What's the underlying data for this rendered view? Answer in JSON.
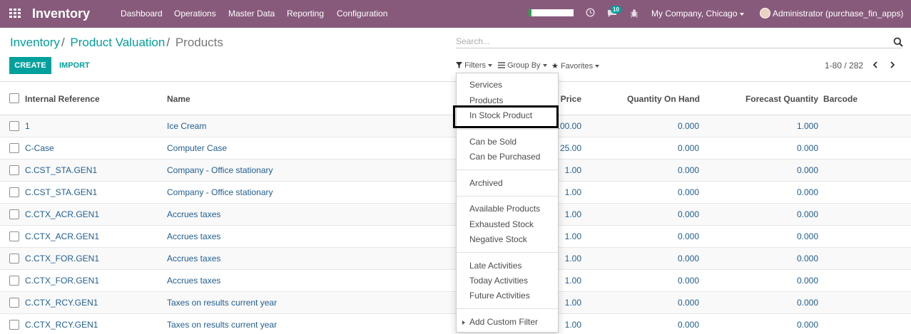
{
  "navbar": {
    "app_name": "Inventory",
    "menu": [
      "Dashboard",
      "Operations",
      "Master Data",
      "Reporting",
      "Configuration"
    ],
    "messages_count": "10",
    "company": "My Company, Chicago",
    "user": "Administrator (purchase_fin_apps)",
    "accent_color": "#875a7b"
  },
  "breadcrumb": [
    "Inventory",
    "Product Valuation",
    "Products"
  ],
  "search": {
    "placeholder": "Search..."
  },
  "buttons": {
    "create": "CREATE",
    "import": "IMPORT"
  },
  "search_options": {
    "filters": "Filters",
    "group_by": "Group By",
    "favorites": "Favorites"
  },
  "pager": {
    "value": "1-80 / 282"
  },
  "table": {
    "columns": [
      "Internal Reference",
      "Name",
      "Sales Price",
      "Quantity On Hand",
      "Forecast Quantity",
      "Barcode"
    ],
    "rows": [
      {
        "ref": "1",
        "name": "Ice Cream",
        "price": "100.00",
        "qty": "0.000",
        "forecast": "1.000"
      },
      {
        "ref": "C-Case",
        "name": "Computer Case",
        "price": "25.00",
        "qty": "0.000",
        "forecast": "0.000"
      },
      {
        "ref": "C.CST_STA.GEN1",
        "name": "Company - Office stationary",
        "price": "1.00",
        "qty": "0.000",
        "forecast": "0.000"
      },
      {
        "ref": "C.CST_STA.GEN1",
        "name": "Company - Office stationary",
        "price": "1.00",
        "qty": "0.000",
        "forecast": "0.000"
      },
      {
        "ref": "C.CTX_ACR.GEN1",
        "name": "Accrues taxes",
        "price": "1.00",
        "qty": "0.000",
        "forecast": "0.000"
      },
      {
        "ref": "C.CTX_ACR.GEN1",
        "name": "Accrues taxes",
        "price": "1.00",
        "qty": "0.000",
        "forecast": "0.000"
      },
      {
        "ref": "C.CTX_FOR.GEN1",
        "name": "Accrues taxes",
        "price": "1.00",
        "qty": "0.000",
        "forecast": "0.000"
      },
      {
        "ref": "C.CTX_FOR.GEN1",
        "name": "Accrues taxes",
        "price": "1.00",
        "qty": "0.000",
        "forecast": "0.000"
      },
      {
        "ref": "C.CTX_RCY.GEN1",
        "name": "Taxes on results current year",
        "price": "1.00",
        "qty": "0.000",
        "forecast": "0.000"
      },
      {
        "ref": "C.CTX_RCY.GEN1",
        "name": "Taxes on results current year",
        "price": "1.00",
        "qty": "0.000",
        "forecast": "0.000"
      }
    ]
  },
  "filters_menu": {
    "items": [
      "Services",
      "Products",
      "In Stock Product",
      "Can be Sold",
      "Can be Purchased",
      "Archived",
      "Available Products",
      "Exhausted Stock",
      "Negative Stock",
      "Late Activities",
      "Today Activities",
      "Future Activities",
      "Add Custom Filter"
    ],
    "highlighted": "In Stock Product"
  }
}
